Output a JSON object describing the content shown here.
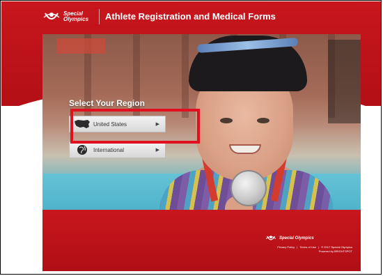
{
  "header": {
    "logo_line1": "Special",
    "logo_line2": "Olympics",
    "title": "Athlete Registration and Medical Forms"
  },
  "region": {
    "heading": "Select Your Region",
    "options": [
      {
        "label": "United States",
        "icon": "us-map-icon"
      },
      {
        "label": "International",
        "icon": "globe-icon"
      }
    ]
  },
  "footer": {
    "logo_text": "Special Olympics",
    "privacy": "Privacy Policy",
    "terms": "Terms of Use",
    "copyright": "© 2017 Special Olympics",
    "powered": "Powered by BRIGHTSPOT"
  },
  "colors": {
    "brand_red": "#c8161d",
    "highlight": "#e01020"
  }
}
